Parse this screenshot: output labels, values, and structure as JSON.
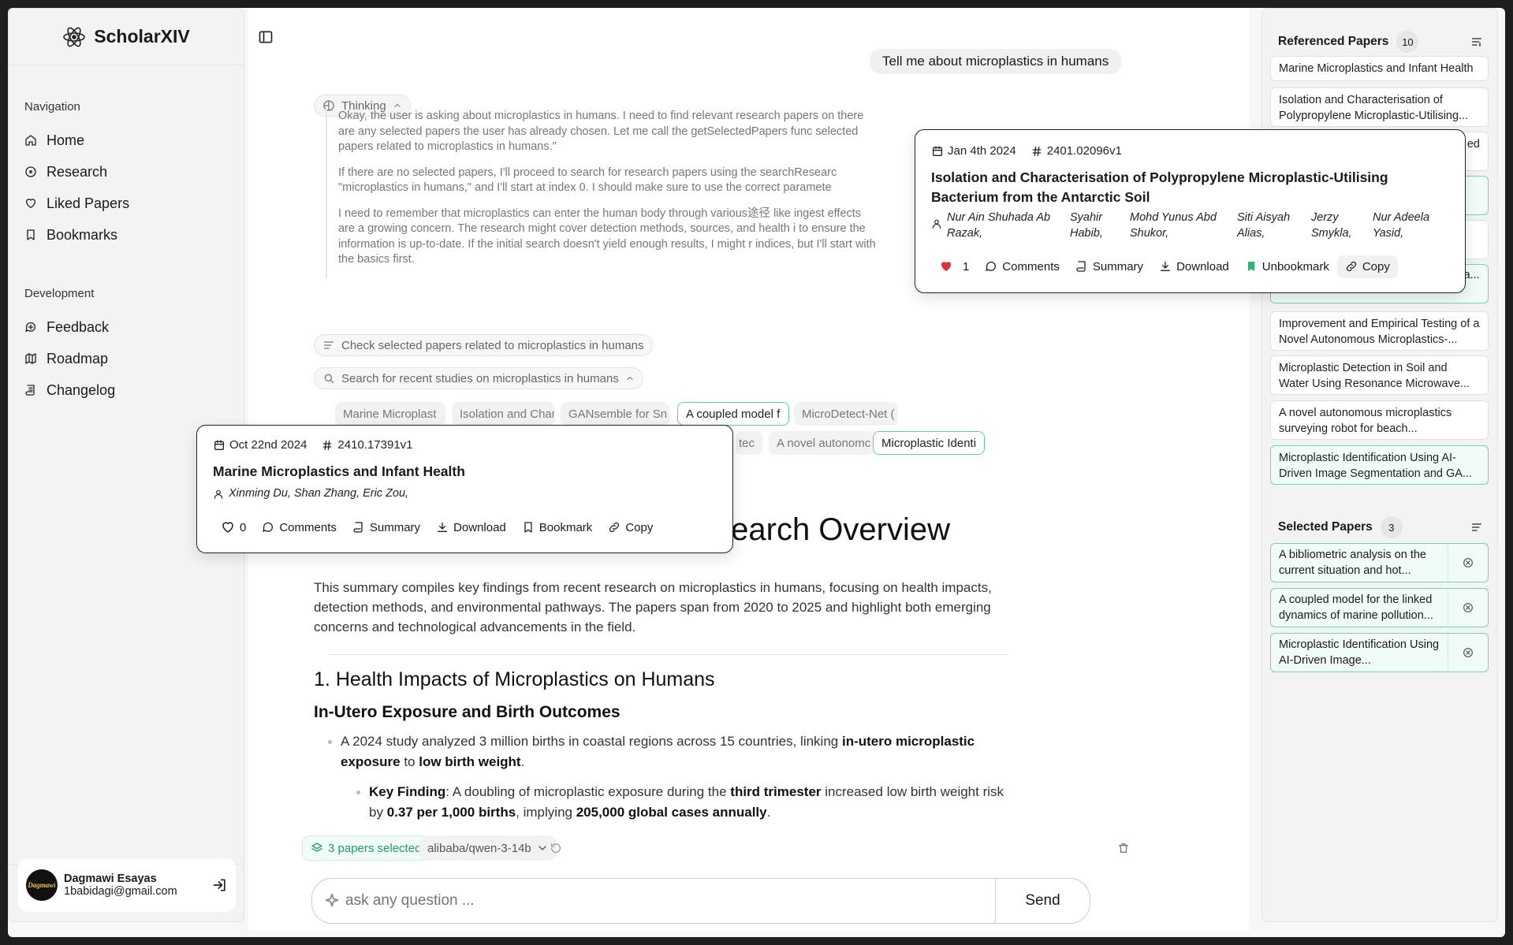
{
  "app": {
    "name": "ScholarXIV"
  },
  "nav": {
    "heading": "Navigation",
    "items": [
      {
        "label": "Home",
        "icon": "home-icon"
      },
      {
        "label": "Research",
        "icon": "compass-icon"
      },
      {
        "label": "Liked Papers",
        "icon": "heart-icon"
      },
      {
        "label": "Bookmarks",
        "icon": "bookmark-icon"
      }
    ],
    "dev_heading": "Development",
    "dev_items": [
      {
        "label": "Feedback",
        "icon": "feedback-icon"
      },
      {
        "label": "Roadmap",
        "icon": "map-icon"
      },
      {
        "label": "Changelog",
        "icon": "scroll-icon"
      }
    ]
  },
  "user": {
    "name": "Dagmawi Esayas",
    "email": "1babidagi@gmail.com"
  },
  "chat": {
    "user_message": "Tell me about microplastics in humans",
    "thinking_label": "Thinking",
    "thinking": [
      "Okay, the user is asking about microplastics in humans. I need to find relevant research papers on there are any selected papers the user has already chosen. Let me call the getSelectedPapers func selected papers related to microplastics in humans.\"",
      "If there are no selected papers, I'll proceed to search for research papers using the searchResearc \"microplastics in humans,\" and I'll start at index 0. I should make sure to use the correct paramete",
      "I need to remember that microplastics can enter the human body through various途径 like ingest effects are a growing concern. The research might cover detection methods, sources, and health i to ensure the information is up-to-date. If the initial search doesn't yield enough results, I might r indices, but I'll start with the basics first."
    ],
    "step1": "Check selected papers related to microplastics in humans",
    "step2": "Search for recent studies on microplastics in humans",
    "tags": [
      "Marine Microplast",
      "Isolation and Char",
      "GANsemble for Sn",
      "A coupled model f",
      "MicroDetect-Net (",
      "tec",
      "A novel autonomc",
      "Microplastic Identi"
    ]
  },
  "article": {
    "title": "Research Overview",
    "intro": "This summary compiles key findings from recent research on microplastics in humans, focusing on health impacts, detection methods, and environmental pathways. The papers span from 2020 to 2025 and highlight both emerging concerns and technological advancements in the field.",
    "h2_num": "1.",
    "h2": "Health Impacts of Microplastics on Humans",
    "h3": "In-Utero Exposure and Birth Outcomes",
    "b1_pre": "A 2024 study analyzed 3 million births in coastal regions across 15 countries, linking ",
    "b1_bold1": "in-utero microplastic exposure",
    "b1_mid": " to ",
    "b1_bold2": "low birth weight",
    "b1_end": ".",
    "b2_key": "Key Finding",
    "b2_pre": ": A doubling of microplastic exposure during the ",
    "b2_bold": "third trimester",
    "b2_post": " increased low birth weight risk",
    "b2_line2a": "by ",
    "b2_line2b": "0.37 per 1,000 births",
    "b2_line2c": ", implying ",
    "b2_line2d": "205,000 global cases annually",
    "b2_line2e": "."
  },
  "composer": {
    "selected": "3 papers selected",
    "model": "alibaba/qwen-3-14b",
    "placeholder": "ask any question ...",
    "send": "Send"
  },
  "popover_left": {
    "date": "Oct 22nd 2024",
    "id": "2410.17391v1",
    "title": "Marine Microplastics and Infant Health",
    "authors": "Xinming Du, Shan Zhang, Eric Zou,",
    "likes": "0",
    "comments": "Comments",
    "summary": "Summary",
    "download": "Download",
    "bookmark": "Bookmark",
    "copy": "Copy"
  },
  "popover_right": {
    "date": "Jan 4th 2024",
    "id": "2401.02096v1",
    "title": "Isolation and Characterisation of Polypropylene Microplastic-Utilising Bacterium from the Antarctic Soil",
    "authors": [
      [
        "Nur Ain Shuhada Ab",
        "Razak,"
      ],
      [
        "Syahir",
        "Habib,"
      ],
      [
        "Mohd Yunus Abd",
        "Shukor,"
      ],
      [
        "Siti Aisyah",
        "Alias,"
      ],
      [
        "Jerzy",
        "Smykla,"
      ],
      [
        "Nur Adeela",
        "Yasid,"
      ]
    ],
    "likes": "1",
    "comments": "Comments",
    "summary": "Summary",
    "download": "Download",
    "bookmark": "Unbookmark",
    "copy": "Copy"
  },
  "referenced": {
    "heading": "Referenced Papers",
    "count": "10",
    "items": [
      "Marine Microplastics and Infant Health",
      "Isolation and Characterisation of Polypropylene Microplastic-Utilising...",
      "ed",
      "",
      "",
      "nt situation and hot trends of the impa...",
      "Improvement and Empirical Testing of a Novel Autonomous Microplastics-...",
      "Microplastic Detection in Soil and Water Using Resonance Microwave...",
      "A novel autonomous microplastics surveying robot for beach...",
      "Microplastic Identification Using AI-Driven Image Segmentation and GA..."
    ]
  },
  "selected": {
    "heading": "Selected Papers",
    "count": "3",
    "items": [
      "A bibliometric analysis on the current situation and hot...",
      "A coupled model for the linked dynamics of marine pollution...",
      "Microplastic Identification Using AI-Driven Image..."
    ]
  }
}
